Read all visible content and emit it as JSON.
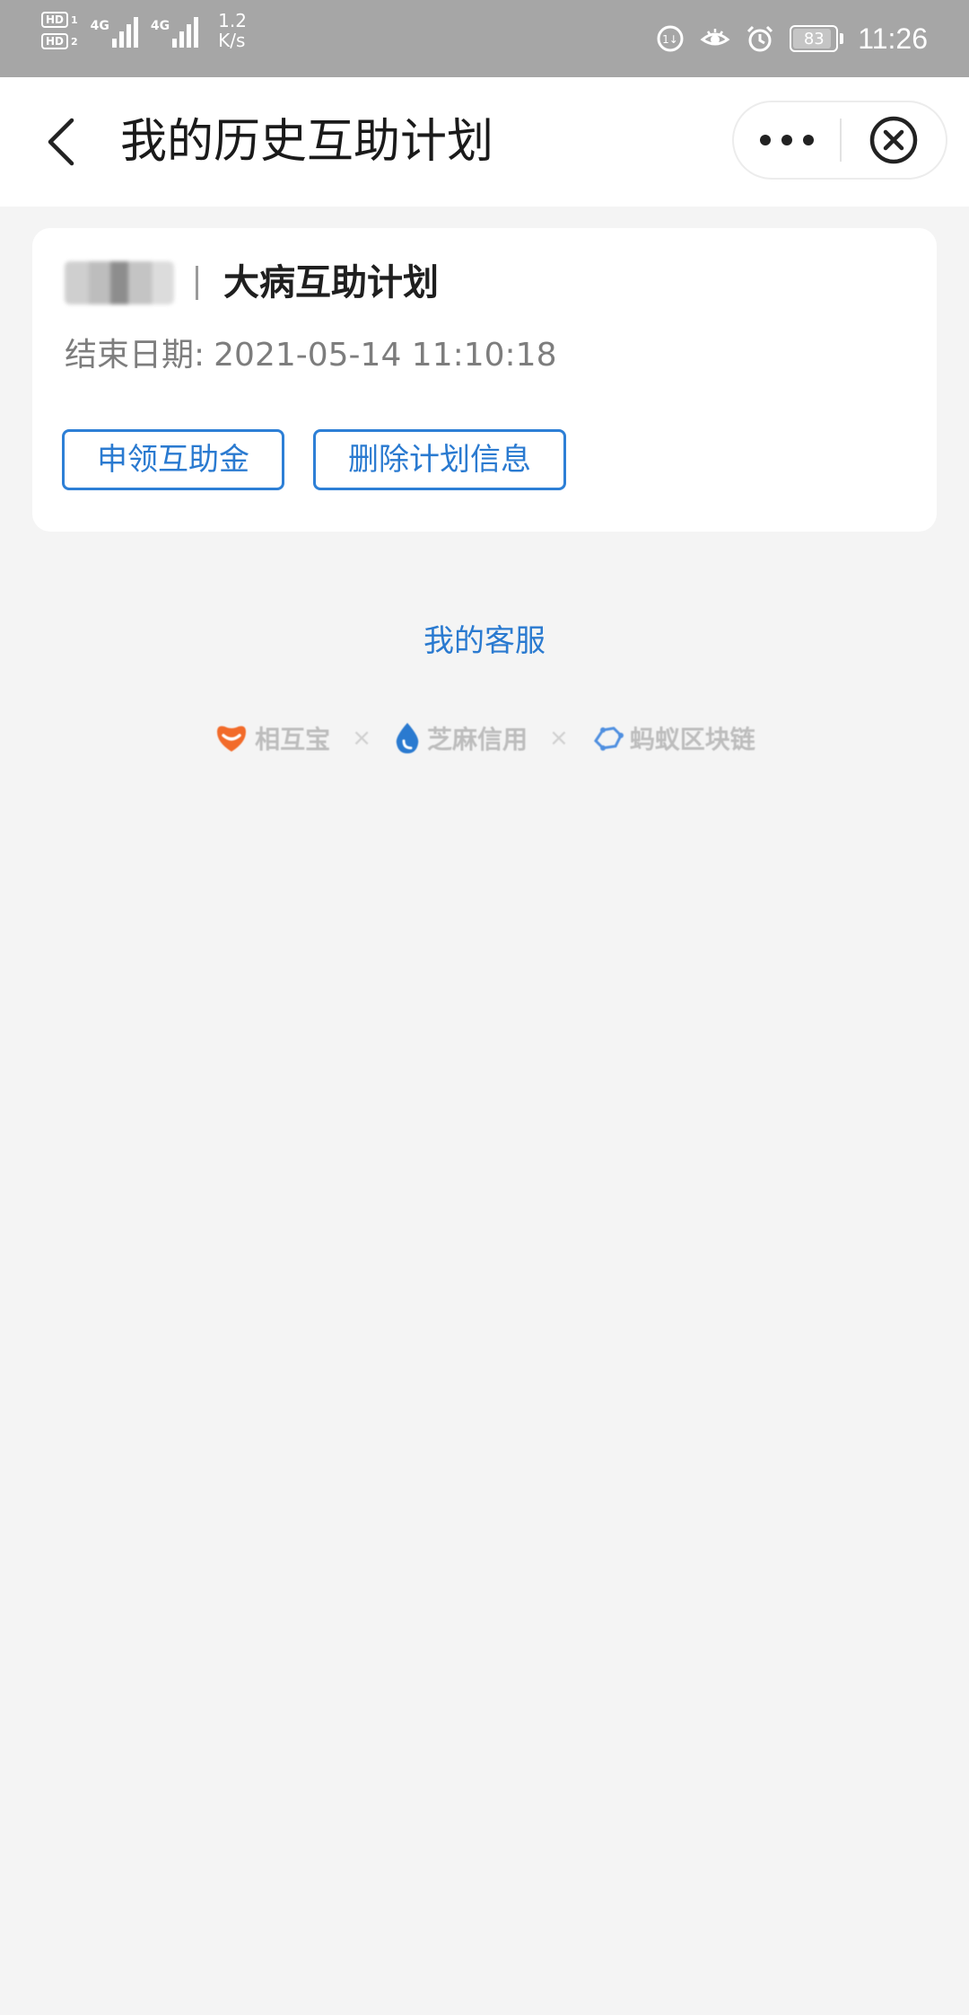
{
  "status_bar": {
    "sim1_badge": "HD",
    "sim1_num": "1",
    "sim2_badge": "HD",
    "sim2_num": "2",
    "network1": "4G",
    "network2": "4G",
    "speed_value": "1.2",
    "speed_unit": "K/s",
    "battery_level": "83",
    "time": "11:26",
    "icons": [
      "hd-sim-icon",
      "signal-icon",
      "data-saver-icon",
      "eye-comfort-icon",
      "alarm-icon",
      "battery-icon"
    ]
  },
  "nav": {
    "title": "我的历史互助计划",
    "back_icon": "chevron-left-icon",
    "more_icon": "more-dots-icon",
    "close_icon": "close-circle-icon"
  },
  "plan_card": {
    "plan_name": "大病互助计划",
    "end_date_label": "结束日期:",
    "end_date_value": "2021-05-14 11:10:18",
    "claim_button": "申领互助金",
    "delete_button": "删除计划信息"
  },
  "service_link": "我的客服",
  "brands": {
    "brand1": "相互宝",
    "brand2": "芝麻信用",
    "brand3": "蚂蚁区块链",
    "separator": "×"
  },
  "colors": {
    "accent_blue": "#2a7ad0",
    "status_bar_bg": "#a6a6a6",
    "page_bg": "#f4f4f4",
    "brand_orange": "#f26b2a",
    "brand_blue": "#2a7ad0"
  }
}
